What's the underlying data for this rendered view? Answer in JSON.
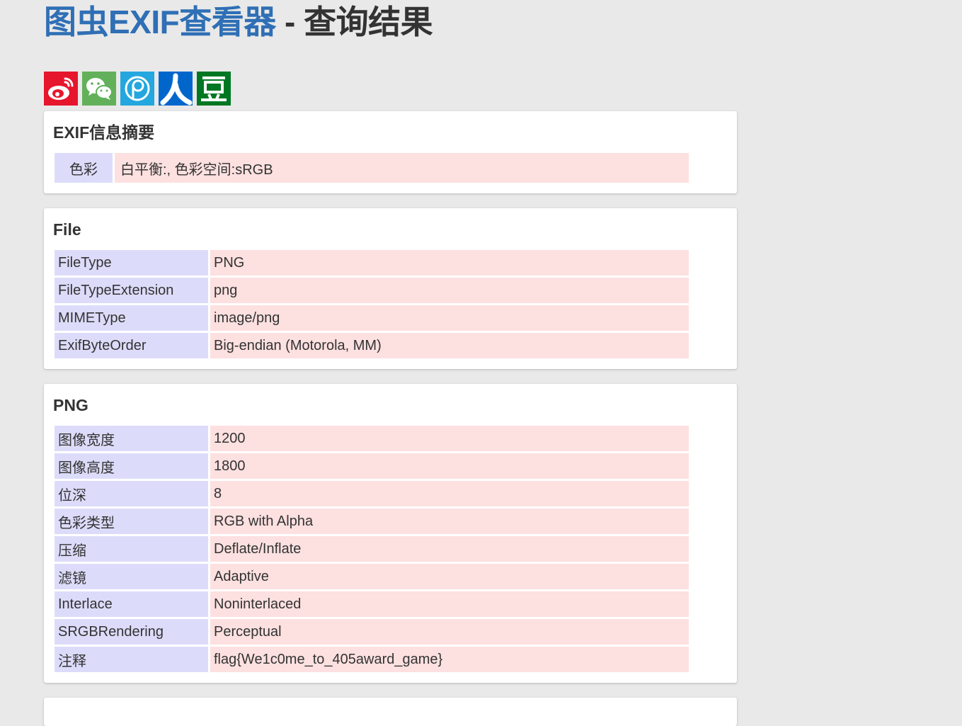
{
  "header": {
    "brand": "图虫EXIF查看器",
    "separator": " - ",
    "title": "查询结果"
  },
  "share": [
    {
      "icon": "weibo-icon",
      "color": "#e6162d"
    },
    {
      "icon": "wechat-icon",
      "color": "#62b15a"
    },
    {
      "icon": "qq-space-icon",
      "color": "#23a7de"
    },
    {
      "icon": "renren-icon",
      "color": "#0066cc"
    },
    {
      "icon": "douban-icon",
      "color": "#007722"
    }
  ],
  "summary": {
    "heading": "EXIF信息摘要",
    "rows": [
      {
        "key": "色彩",
        "value": "白平衡:, 色彩空间:sRGB"
      }
    ]
  },
  "file": {
    "heading": "File",
    "rows": [
      {
        "key": "FileType",
        "value": "PNG"
      },
      {
        "key": "FileTypeExtension",
        "value": "png"
      },
      {
        "key": "MIMEType",
        "value": "image/png"
      },
      {
        "key": "ExifByteOrder",
        "value": "Big-endian (Motorola, MM)"
      }
    ]
  },
  "png": {
    "heading": "PNG",
    "rows": [
      {
        "key": "图像宽度",
        "value": "1200"
      },
      {
        "key": "图像高度",
        "value": "1800"
      },
      {
        "key": "位深",
        "value": "8"
      },
      {
        "key": "色彩类型",
        "value": "RGB with Alpha"
      },
      {
        "key": "压缩",
        "value": "Deflate/Inflate"
      },
      {
        "key": "滤镜",
        "value": "Adaptive"
      },
      {
        "key": "Interlace",
        "value": "Noninterlaced"
      },
      {
        "key": "SRGBRendering",
        "value": "Perceptual"
      },
      {
        "key": "注释",
        "value": "flag{We1c0me_to_405award_game}"
      }
    ]
  },
  "colors": {
    "brand": "#2f6fb5",
    "key_cell": "#dcdcfa",
    "value_cell": "#fde0e0",
    "background": "#e9e9e9"
  }
}
